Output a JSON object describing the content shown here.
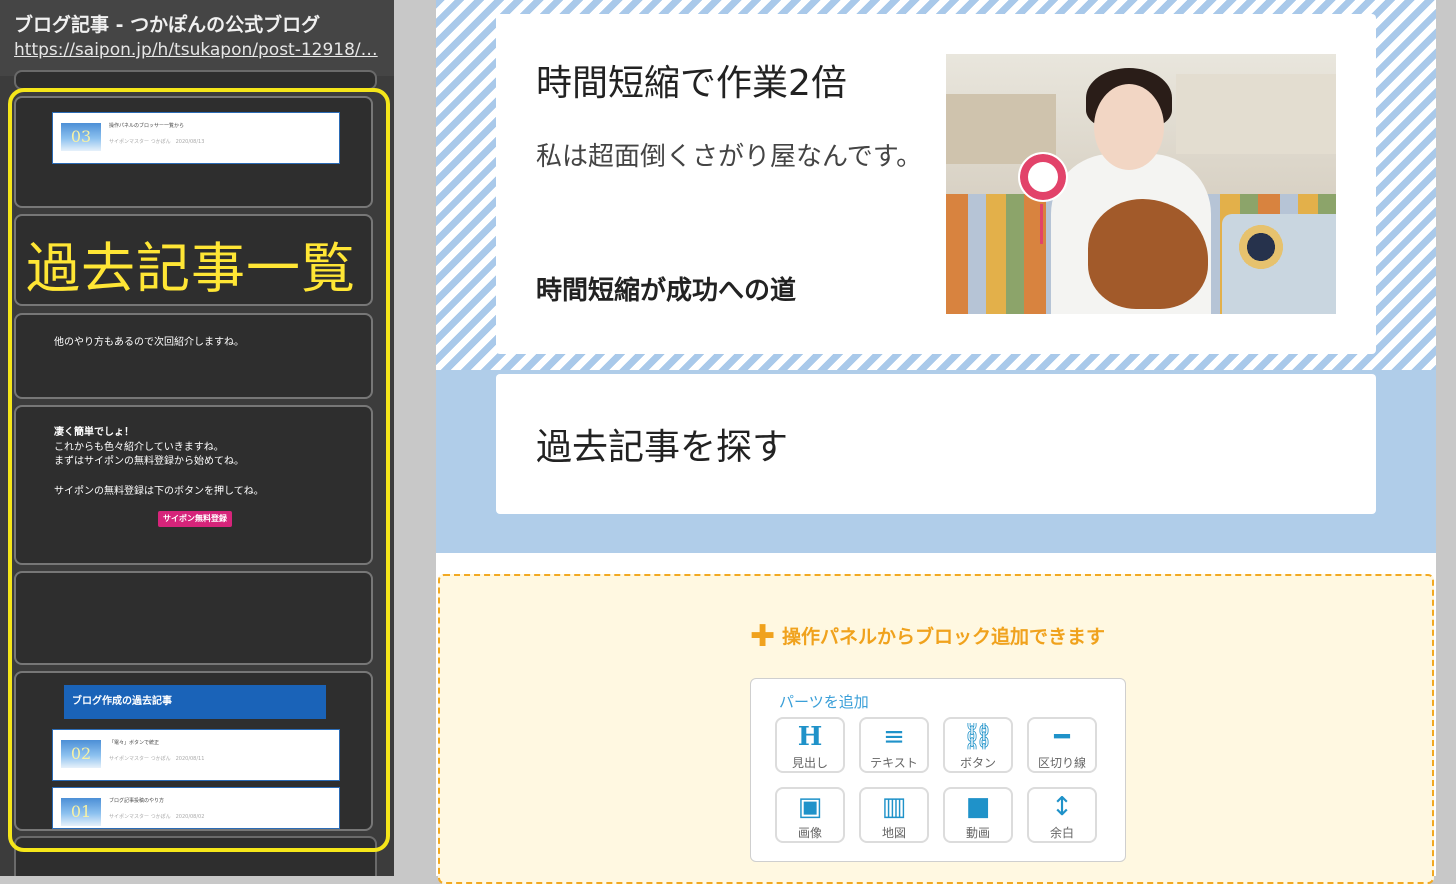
{
  "panel": {
    "title": "ブログ記事 - つかぽんの公式ブログ",
    "url": "https://saipon.jp/h/tsukapon/post-12918/…"
  },
  "thumbs": {
    "article_top": {
      "thumb_no": "03",
      "title": "操作パネルのブロッサー一覧から",
      "meta": "サイポンマスター つかぽん　2020/08/13"
    },
    "heading_past": "過去記事一覧",
    "text_next": "他のやり方もあるので次回紹介しますね。",
    "easy_line1": "凄く簡単でしょ！",
    "easy_line2": "これからも色々紹介していきますね。",
    "easy_line3": "まずはサイポンの無料登録から始めてね。",
    "easy_line4": "サイポンの無料登録は下のボタンを押してね。",
    "signup_button": "サイポン無料登録",
    "blog_bar": "ブログ作成の過去記事",
    "article2": {
      "thumb_no": "02",
      "title": "「電々」ボタンで統正",
      "meta": "サイポンマスター つかぽん　2020/08/11"
    },
    "article1": {
      "thumb_no": "01",
      "title": "ブログ記事投稿のやり方",
      "meta": "サイポンマスター つかぽん　2020/08/02"
    }
  },
  "canvas": {
    "card1": {
      "heading": "時間短縮で作業2倍",
      "body": "私は超面倒くさがり屋なんです。",
      "strong": "時間短縮が成功への道"
    },
    "card2": {
      "heading": "過去記事を探す"
    }
  },
  "add_block": {
    "hint": "操作パネルからブロック追加できます",
    "parts_title": "パーツを追加",
    "parts": [
      {
        "icon": "heading-icon",
        "glyph": "H",
        "label": "見出し"
      },
      {
        "icon": "text-icon",
        "glyph": "≡",
        "label": "テキスト"
      },
      {
        "icon": "link-icon",
        "glyph": "⛓",
        "label": "ボタン"
      },
      {
        "icon": "divider-icon",
        "glyph": "━",
        "label": "区切り線"
      },
      {
        "icon": "image-icon",
        "glyph": "▣",
        "label": "画像"
      },
      {
        "icon": "map-icon",
        "glyph": "▥",
        "label": "地図"
      },
      {
        "icon": "video-icon",
        "glyph": "■",
        "label": "動画"
      },
      {
        "icon": "spacer-icon",
        "glyph": "↕",
        "label": "余白"
      }
    ]
  },
  "colors": {
    "accent_yellow": "#f5e61a",
    "hint_orange": "#f0a21d",
    "blue": "#1f92c9",
    "signup_pink": "#d6247a"
  }
}
